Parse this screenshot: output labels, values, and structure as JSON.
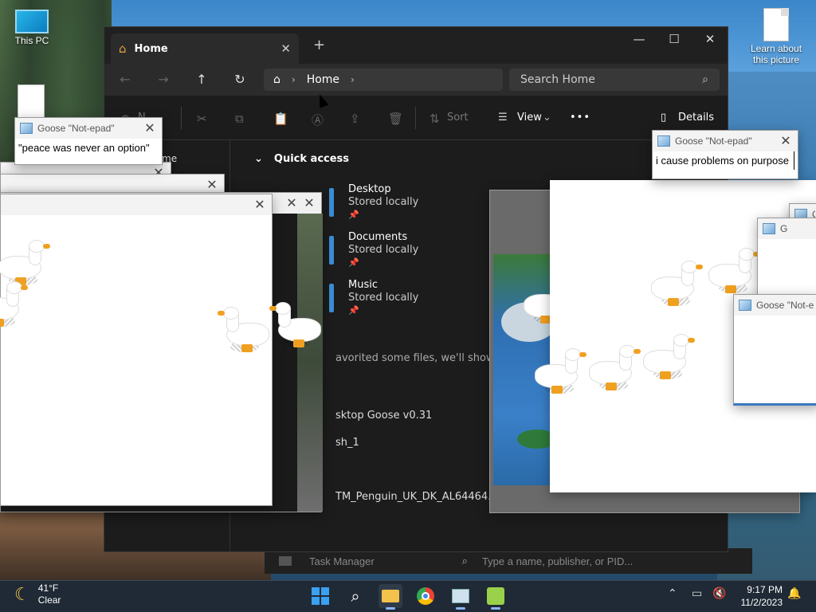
{
  "desktop": {
    "icons": [
      {
        "label": "This PC"
      },
      {
        "label": "Learn about this picture"
      }
    ]
  },
  "explorer": {
    "tab_title": "Home",
    "new_tab": "+",
    "breadcrumb": "Home",
    "search_placeholder": "Search Home",
    "toolbar": {
      "new_label": "N",
      "sort_label": "Sort",
      "view_label": "View",
      "more_label": "•••",
      "details_label": "Details"
    },
    "sidebar_partial": "me",
    "quick_access": {
      "heading": "Quick access",
      "items": [
        {
          "name": "Desktop",
          "status": "Stored locally"
        },
        {
          "name": "Documents",
          "status": "Stored locally"
        },
        {
          "name": "Music",
          "status": "Stored locally"
        }
      ]
    },
    "favorites_hint": "avorited some files, we'll show them",
    "recent": [
      "sktop Goose v0.31",
      "sh_1",
      "TM_Penguin_UK_DK_AL64464..."
    ]
  },
  "notepads": [
    {
      "title": "Goose \"Not-epad\"",
      "text": "\"peace was never an option\""
    },
    {
      "title": "Goose \"Not-epad\"",
      "text": "i cause problems on purpose"
    },
    {
      "title": "Goose \"Not-e",
      "text": ""
    },
    {
      "title": "G",
      "text": ""
    }
  ],
  "task_manager": {
    "title": "Task Manager",
    "search_placeholder": "Type a name, publisher, or PID..."
  },
  "taskbar": {
    "weather_temp": "41°F",
    "weather_cond": "Clear",
    "time": "9:17 PM",
    "date": "11/2/2023"
  },
  "colors": {
    "explorer_bg": "#1c1c1c",
    "accent": "#3a8fd6",
    "taskbar": "#1f2a36",
    "goose_beak": "#f0a020"
  }
}
